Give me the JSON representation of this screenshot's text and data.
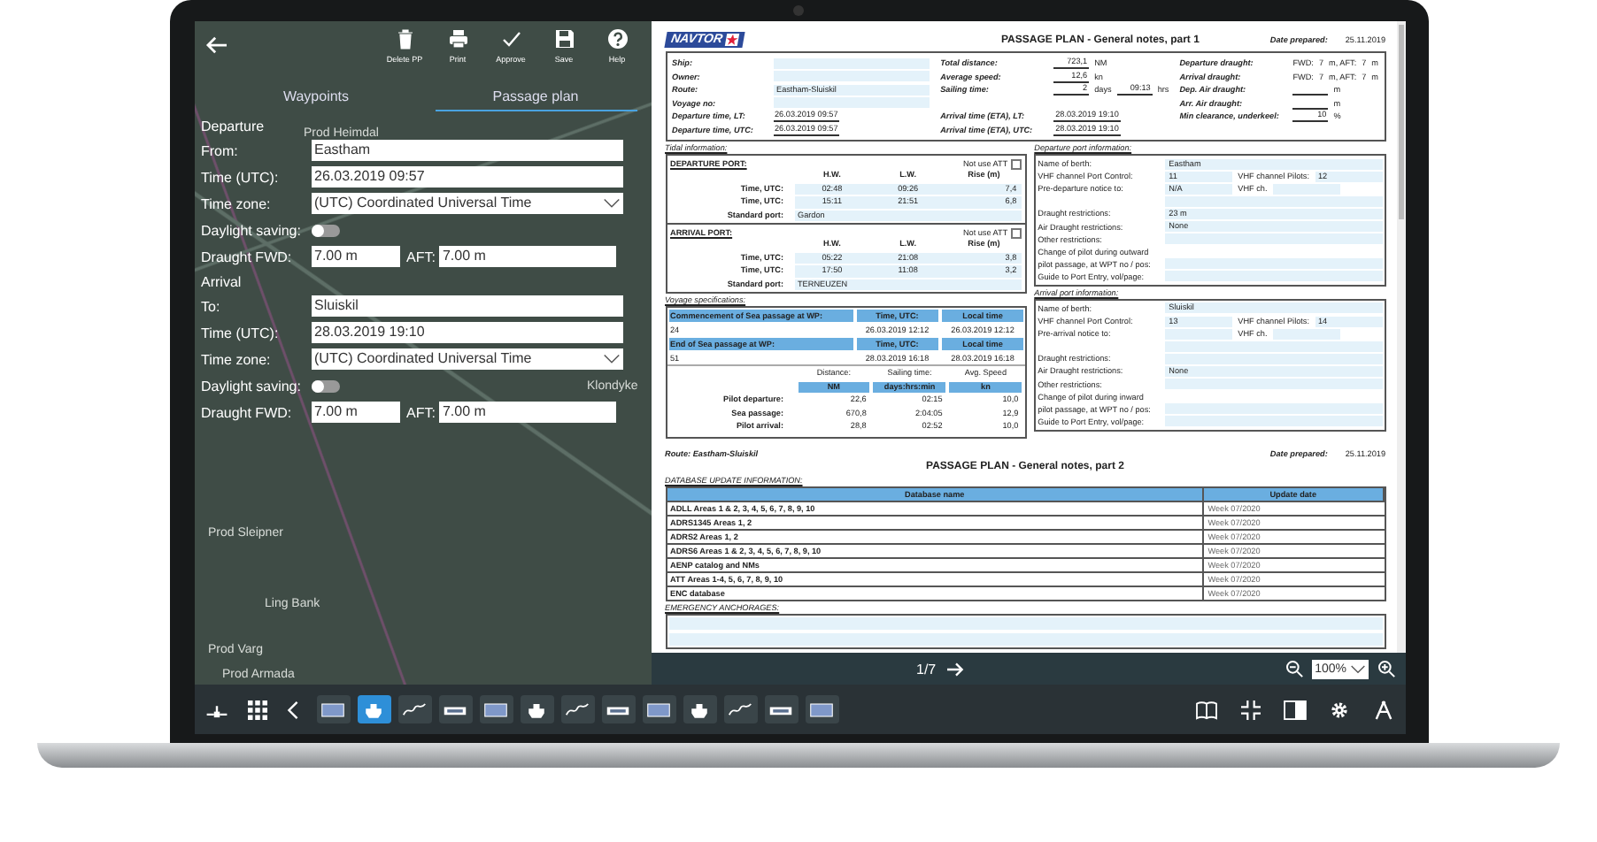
{
  "left_panel": {
    "toolbar": [
      {
        "label": "Delete PP"
      },
      {
        "label": "Print"
      },
      {
        "label": "Approve"
      },
      {
        "label": "Save"
      },
      {
        "label": "Help"
      }
    ],
    "tabs": [
      {
        "label": "Waypoints",
        "selected": false
      },
      {
        "label": "Passage plan",
        "selected": true
      }
    ],
    "sections": [
      {
        "title": "Departure",
        "fields": [
          {
            "kind": "text",
            "label": "From:",
            "value": "Eastham"
          },
          {
            "kind": "text",
            "label": "Time (UTC):",
            "value": "26.03.2019 09:57"
          },
          {
            "kind": "select",
            "label": "Time zone:",
            "value": "(UTC) Coordinated Universal Time"
          },
          {
            "kind": "toggle",
            "label": "Daylight saving:",
            "on": false
          },
          {
            "kind": "draught",
            "label": "Draught FWD:",
            "value": "7.00 m",
            "aft_label": "AFT:",
            "aft_value": "7.00 m"
          }
        ]
      },
      {
        "title": "Arrival",
        "fields": [
          {
            "kind": "text",
            "label": "To:",
            "value": "Sluiskil"
          },
          {
            "kind": "text",
            "label": "Time (UTC):",
            "value": "28.03.2019 19:10"
          },
          {
            "kind": "select",
            "label": "Time zone:",
            "value": "(UTC) Coordinated Universal Time"
          },
          {
            "kind": "toggle",
            "label": "Daylight saving:",
            "on": false
          },
          {
            "kind": "draught",
            "label": "Draught FWD:",
            "value": "7.00 m",
            "aft_label": "AFT:",
            "aft_value": "7.00 m"
          }
        ]
      }
    ]
  },
  "map_labels": [
    "Prod Heimdal",
    "Klondyke",
    "Prod Sleipner",
    "Ling Bank",
    "Prod Varg",
    "Prod Armada"
  ],
  "document": {
    "logo": "NAVTOR",
    "part1": {
      "title": "PASSAGE PLAN - General notes, part 1",
      "date_label": "Date prepared:",
      "date": "25.11.2019",
      "summary": [
        [
          {
            "label": "Ship:",
            "parts": [
              {
                "kind": "bar"
              }
            ]
          },
          {
            "label": "Owner:",
            "parts": [
              {
                "kind": "bar"
              }
            ]
          },
          {
            "label": "Route:",
            "parts": [
              {
                "kind": "bar",
                "text": "Eastham-Sluiskil"
              }
            ]
          },
          {
            "label": "Voyage no:",
            "parts": [
              {
                "kind": "bar"
              }
            ]
          },
          {
            "label": "Departure time, LT:",
            "parts": [
              {
                "kind": "field",
                "text": "26.03.2019 09:57"
              }
            ]
          },
          {
            "label": "Departure time, UTC:",
            "parts": [
              {
                "kind": "field",
                "text": "26.03.2019 09:57"
              }
            ]
          }
        ],
        [
          {
            "label": "Total distance:",
            "parts": [
              {
                "kind": "field",
                "text": "723,1"
              },
              {
                "kind": "text",
                "text": "NM"
              }
            ]
          },
          {
            "label": "Average speed:",
            "parts": [
              {
                "kind": "field",
                "text": "12,6"
              },
              {
                "kind": "text",
                "text": "kn"
              }
            ]
          },
          {
            "label": "Sailing time:",
            "parts": [
              {
                "kind": "field",
                "text": "2"
              },
              {
                "kind": "text",
                "text": "days"
              },
              {
                "kind": "field",
                "text": "09:13"
              },
              {
                "kind": "text",
                "text": "hrs"
              }
            ]
          },
          {
            "label": "Arrival time (ETA), LT:",
            "parts": [
              {
                "kind": "field",
                "text": "28.03.2019 19:10"
              }
            ]
          },
          {
            "label": "Arrival time (ETA), UTC:",
            "parts": [
              {
                "kind": "field",
                "text": "28.03.2019 19:10"
              }
            ]
          }
        ],
        [
          {
            "label": "Departure draught:",
            "parts": [
              {
                "kind": "text",
                "text": "FWD:"
              },
              {
                "kind": "text",
                "text": "7"
              },
              {
                "kind": "text",
                "text": "m, AFT:"
              },
              {
                "kind": "text",
                "text": "7"
              },
              {
                "kind": "text",
                "text": "m"
              }
            ]
          },
          {
            "label": "Arrival draught:",
            "parts": [
              {
                "kind": "text",
                "text": "FWD:"
              },
              {
                "kind": "text",
                "text": "7"
              },
              {
                "kind": "text",
                "text": "m, AFT:"
              },
              {
                "kind": "text",
                "text": "7"
              },
              {
                "kind": "text",
                "text": "m"
              }
            ]
          },
          {
            "label": "Dep. Air draught:",
            "parts": [
              {
                "kind": "field"
              },
              {
                "kind": "text",
                "text": "m"
              }
            ]
          },
          {
            "label": "Arr. Air draught:",
            "parts": [
              {
                "kind": "field"
              },
              {
                "kind": "text",
                "text": "m"
              }
            ]
          },
          {
            "label": "Min clearance, underkeel:",
            "parts": [
              {
                "kind": "field",
                "text": "10"
              },
              {
                "kind": "text",
                "text": "%"
              }
            ]
          }
        ]
      ],
      "tidal_title": "Tidal information:",
      "tidal": [
        {
          "title": "DEPARTURE PORT:",
          "att_label": "Not use ATT",
          "att_checked": false,
          "headers": [
            "H.W.",
            "L.W.",
            "Rise (m)"
          ],
          "rows": [
            {
              "label": "Time, UTC:",
              "cells": [
                "02:48",
                "09:26",
                "7,4"
              ]
            },
            {
              "label": "Time, UTC:",
              "cells": [
                "15:11",
                "21:51",
                "6,8"
              ]
            }
          ],
          "std_label": "Standard port:",
          "std": "Gardon"
        },
        {
          "title": "ARRIVAL PORT:",
          "att_label": "Not use ATT",
          "att_checked": false,
          "headers": [
            "H.W.",
            "L.W.",
            "Rise (m)"
          ],
          "rows": [
            {
              "label": "Time, UTC:",
              "cells": [
                "05:22",
                "21:08",
                "3,8"
              ]
            },
            {
              "label": "Time, UTC:",
              "cells": [
                "17:50",
                "11:08",
                "3,2"
              ]
            }
          ],
          "std_label": "Standard port:",
          "std": "TERNEUZEN"
        }
      ],
      "voyage_title": "Voyage specifications:",
      "passage": [
        {
          "label": "Commencement of Sea passage at WP:",
          "time_header": "Time, UTC:",
          "local_header": "Local time",
          "wp": "24",
          "time": "26.03.2019 12:12",
          "local": "26.03.2019 12:12"
        },
        {
          "label": "End of Sea passage at WP:",
          "time_header": "Time, UTC:",
          "local_header": "Local time",
          "wp": "51",
          "time": "28.03.2019 16:18",
          "local": "28.03.2019 16:18"
        }
      ],
      "legs": {
        "headers": [
          {
            "title": "Distance:",
            "unit": "NM"
          },
          {
            "title": "Sailing time:",
            "unit": "days:hrs:min"
          },
          {
            "title": "Avg. Speed",
            "unit": "kn"
          }
        ],
        "rows": [
          {
            "label": "Pilot departure:",
            "cells": [
              "22,6",
              "02:15",
              "10,0"
            ]
          },
          {
            "label": "Sea passage:",
            "cells": [
              "670,8",
              "2:04:05",
              "12,9"
            ]
          },
          {
            "label": "Pilot arrival:",
            "cells": [
              "28,8",
              "02:52",
              "10,0"
            ]
          }
        ]
      },
      "port_info": [
        {
          "title": "Departure port information:",
          "rows": [
            {
              "label": "Name of berth:",
              "parts": [
                {
                  "kind": "bar",
                  "text": "Eastham"
                }
              ]
            },
            {
              "label": "VHF channel Port Control:",
              "parts": [
                {
                  "kind": "field",
                  "text": "11"
                },
                {
                  "kind": "text",
                  "text": "VHF channel Pilots:"
                },
                {
                  "kind": "field",
                  "text": "12"
                }
              ]
            },
            {
              "label": "Pre-departure notice to:",
              "parts": [
                {
                  "kind": "field",
                  "text": "N/A"
                },
                {
                  "kind": "text",
                  "text": "VHF ch."
                },
                {
                  "kind": "field"
                }
              ]
            },
            {
              "parts": [
                {
                  "kind": "bar"
                }
              ]
            },
            {
              "label": "Draught restrictions:",
              "parts": [
                {
                  "kind": "bar",
                  "text": "23 m"
                }
              ]
            },
            {
              "label": "Air Draught restrictions:",
              "parts": [
                {
                  "kind": "bar",
                  "text": "None"
                }
              ]
            },
            {
              "label": "Other restrictions:",
              "parts": [
                {
                  "kind": "bar"
                }
              ]
            },
            {
              "label": "Change of pilot during outward",
              "parts": []
            },
            {
              "label": "pilot passage, at WPT no / pos:",
              "parts": [
                {
                  "kind": "bar"
                }
              ]
            },
            {
              "label": "Guide to Port Entry, vol/page:",
              "parts": [
                {
                  "kind": "bar"
                }
              ]
            }
          ]
        },
        {
          "title": "Arrival port information:",
          "rows": [
            {
              "label": "Name of berth:",
              "parts": [
                {
                  "kind": "bar",
                  "text": "Sluiskil"
                }
              ]
            },
            {
              "label": "VHF channel Port Control:",
              "parts": [
                {
                  "kind": "field",
                  "text": "13"
                },
                {
                  "kind": "text",
                  "text": "VHF channel Pilots:"
                },
                {
                  "kind": "field",
                  "text": "14"
                }
              ]
            },
            {
              "label": "Pre-arrival notice to:",
              "parts": [
                {
                  "kind": "field"
                },
                {
                  "kind": "text",
                  "text": "VHF ch."
                },
                {
                  "kind": "field"
                }
              ]
            },
            {
              "parts": [
                {
                  "kind": "bar"
                }
              ]
            },
            {
              "label": "Draught restrictions:",
              "parts": [
                {
                  "kind": "bar"
                }
              ]
            },
            {
              "label": "Air Draught restrictions:",
              "parts": [
                {
                  "kind": "bar",
                  "text": "None"
                }
              ]
            },
            {
              "label": "Other restrictions:",
              "parts": [
                {
                  "kind": "bar"
                }
              ]
            },
            {
              "label": "Change of pilot during inward",
              "parts": []
            },
            {
              "label": "pilot passage, at WPT no / pos:",
              "parts": [
                {
                  "kind": "bar"
                }
              ]
            },
            {
              "label": "Guide to Port Entry, vol/page:",
              "parts": [
                {
                  "kind": "bar"
                }
              ]
            }
          ]
        }
      ]
    },
    "part2": {
      "route": "Route: Eastham-Sluiskil",
      "date_label": "Date prepared:",
      "date": "25.11.2019",
      "title": "PASSAGE PLAN - General notes, part 2",
      "db_title": "DATABASE UPDATE INFORMATION:",
      "db_headers": [
        "Database name",
        "Update date"
      ],
      "db_rows": [
        [
          "ADLL Areas 1 & 2, 3, 4, 5, 6, 7, 8, 9, 10",
          "Week 07/2020"
        ],
        [
          "ADRS1345 Areas 1, 2",
          "Week 07/2020"
        ],
        [
          "ADRS2 Areas 1, 2",
          "Week 07/2020"
        ],
        [
          "ADRS6 Areas 1 & 2, 3, 4, 5, 6, 7, 8, 9, 10",
          "Week 07/2020"
        ],
        [
          "AENP catalog and NMs",
          "Week 07/2020"
        ],
        [
          "ATT Areas 1-4, 5, 6, 7, 8, 9, 10",
          "Week 07/2020"
        ],
        [
          "ENC database",
          "Week 07/2020"
        ]
      ],
      "anchorage_title": "EMERGENCY ANCHORAGES:"
    }
  },
  "pager": {
    "page": "1/7",
    "zoom": "100%"
  },
  "taskbar": {
    "tools": [
      {
        "selected": false
      },
      {
        "selected": true
      },
      {
        "selected": false
      },
      {
        "selected": false
      },
      {
        "selected": false
      },
      {
        "selected": false
      },
      {
        "selected": false
      },
      {
        "selected": false
      },
      {
        "selected": false
      },
      {
        "selected": false
      },
      {
        "selected": false
      },
      {
        "selected": false
      },
      {
        "selected": false
      }
    ]
  }
}
